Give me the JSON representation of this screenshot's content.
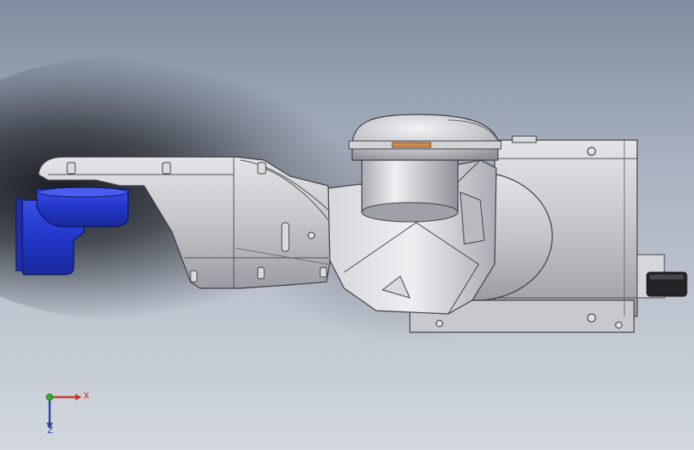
{
  "scene": {
    "background_top": "#7f8da0",
    "background_bottom": "#d3d8df",
    "part_color": "#c6c8cc",
    "accent_blue": "#2437c9",
    "accent_copper": "#d08a52"
  },
  "triad": {
    "x_label": "X",
    "z_label": "Z",
    "x_color": "#d0322a",
    "y_color": "#2fae2f",
    "z_color": "#2d3fa8"
  }
}
